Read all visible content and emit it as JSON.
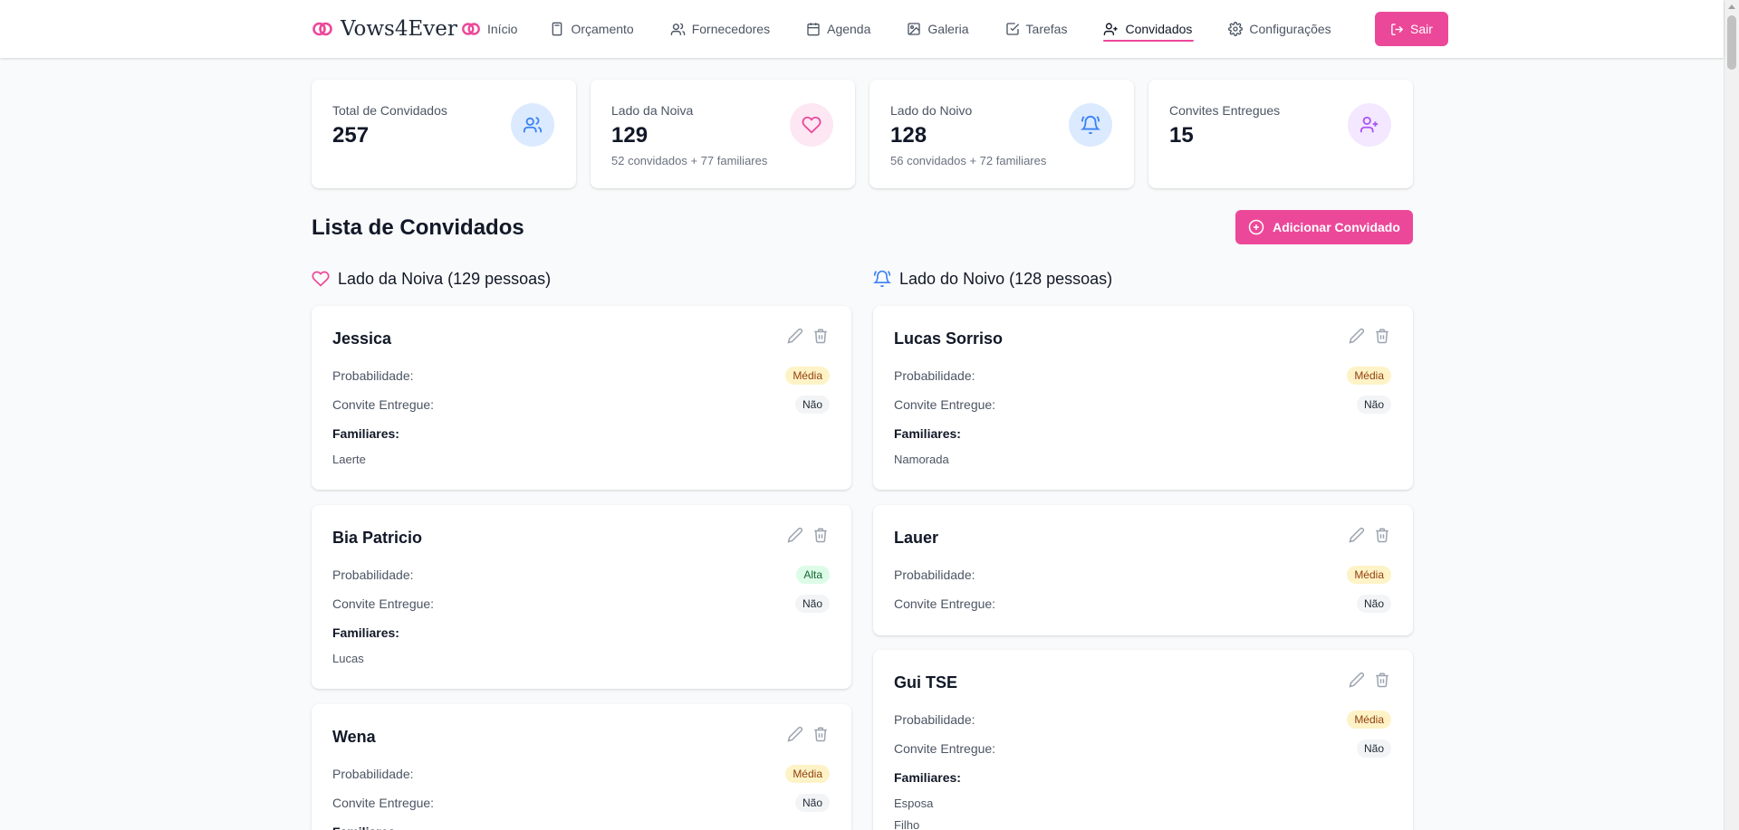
{
  "colors": {
    "accent": "#ec4899",
    "bride": "#ec4899",
    "groom": "#3b82f6"
  },
  "brand": {
    "name": "Vows4Ever",
    "icon": "rings-icon"
  },
  "nav": [
    {
      "label": "Início",
      "icon": "rings-icon"
    },
    {
      "label": "Orçamento",
      "icon": "calculator-icon"
    },
    {
      "label": "Fornecedores",
      "icon": "users-icon"
    },
    {
      "label": "Agenda",
      "icon": "calendar-icon"
    },
    {
      "label": "Galeria",
      "icon": "image-icon"
    },
    {
      "label": "Tarefas",
      "icon": "check-square-icon"
    },
    {
      "label": "Convidados",
      "icon": "user-plus-icon",
      "active": true
    },
    {
      "label": "Configurações",
      "icon": "gear-icon"
    }
  ],
  "logout_label": "Sair",
  "stats": [
    {
      "label": "Total de Convidados",
      "value": "257",
      "sub": "",
      "icon": "users-icon"
    },
    {
      "label": "Lado da Noiva",
      "value": "129",
      "sub": "52 convidados + 77 familiares",
      "icon": "heart-icon"
    },
    {
      "label": "Lado do Noivo",
      "value": "128",
      "sub": "56 convidados + 72 familiares",
      "icon": "bell-icon"
    },
    {
      "label": "Convites Entregues",
      "value": "15",
      "sub": "",
      "icon": "user-plus-icon"
    }
  ],
  "section_title": "Lista de Convidados",
  "add_button_label": "Adicionar Convidado",
  "labels": {
    "probability": "Probabilidade:",
    "invite": "Convite Entregue:",
    "family": "Familiares:"
  },
  "bride": {
    "heading": "Lado da Noiva (129 pessoas)",
    "guests": [
      {
        "name": "Jessica",
        "probability": "Média",
        "invite": "Não",
        "family": [
          "Laerte"
        ]
      },
      {
        "name": "Bia Patricio",
        "probability": "Alta",
        "invite": "Não",
        "family": [
          "Lucas"
        ]
      },
      {
        "name": "Wena",
        "probability": "Média",
        "invite": "Não",
        "family": []
      }
    ]
  },
  "groom": {
    "heading": "Lado do Noivo (128 pessoas)",
    "guests": [
      {
        "name": "Lucas Sorriso",
        "probability": "Média",
        "invite": "Não",
        "family": [
          "Namorada"
        ]
      },
      {
        "name": "Lauer",
        "probability": "Média",
        "invite": "Não",
        "family": []
      },
      {
        "name": "Gui TSE",
        "probability": "Média",
        "invite": "Não",
        "family": [
          "Esposa",
          "Filho"
        ]
      }
    ]
  }
}
